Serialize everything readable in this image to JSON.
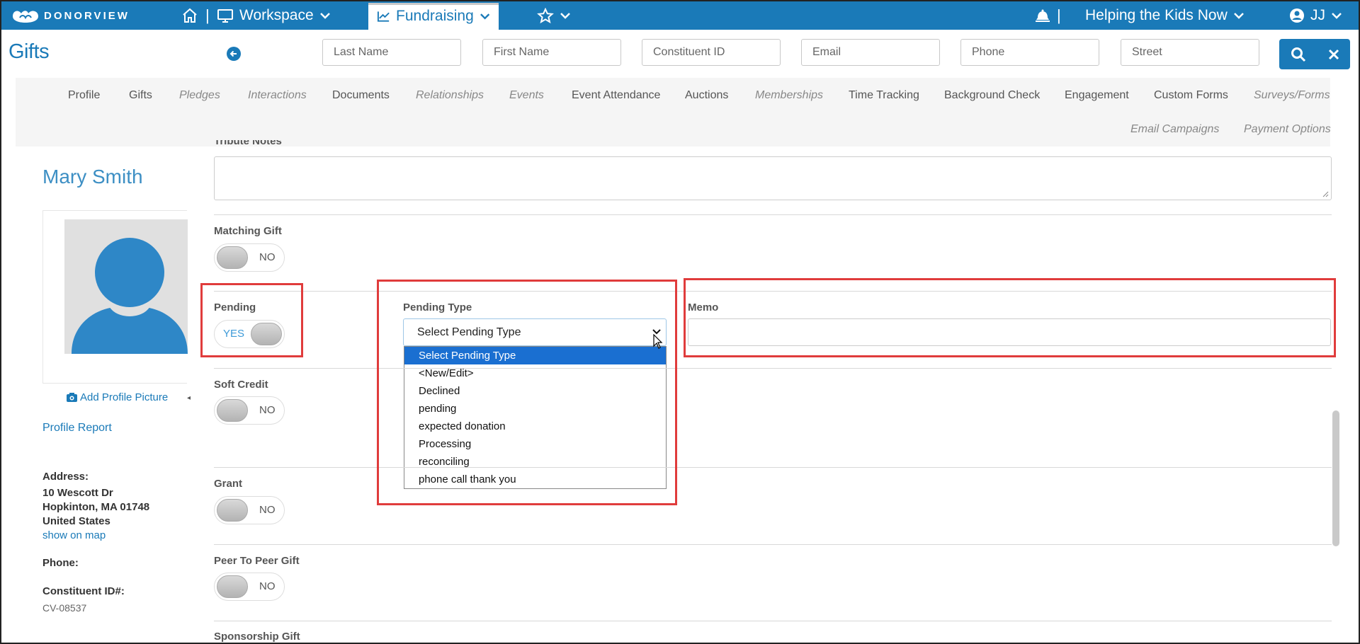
{
  "topbar": {
    "logo_text": "DONORVIEW",
    "workspace_label": "Workspace",
    "fundraising_label": "Fundraising",
    "org_name": "Helping the Kids Now",
    "user_initials": "JJ",
    "separator": "|"
  },
  "header": {
    "page_title": "Gifts",
    "search_fields": [
      {
        "placeholder": "Last Name"
      },
      {
        "placeholder": "First Name"
      },
      {
        "placeholder": "Constituent ID"
      },
      {
        "placeholder": "Email"
      },
      {
        "placeholder": "Phone"
      },
      {
        "placeholder": "Street"
      }
    ]
  },
  "tabs": {
    "row1": [
      {
        "label": "Profile",
        "italic": false
      },
      {
        "label": "Gifts",
        "italic": false
      },
      {
        "label": "Pledges",
        "italic": true
      },
      {
        "label": "Interactions",
        "italic": true
      },
      {
        "label": "Documents",
        "italic": false
      },
      {
        "label": "Relationships",
        "italic": true
      },
      {
        "label": "Events",
        "italic": true
      },
      {
        "label": "Event Attendance",
        "italic": false
      },
      {
        "label": "Auctions",
        "italic": false
      },
      {
        "label": "Memberships",
        "italic": true
      },
      {
        "label": "Time Tracking",
        "italic": false
      },
      {
        "label": "Background Check",
        "italic": false
      },
      {
        "label": "Engagement",
        "italic": false
      },
      {
        "label": "Custom Forms",
        "italic": false
      },
      {
        "label": "Surveys/Forms",
        "italic": true
      }
    ],
    "row2": [
      {
        "label": "Email Campaigns",
        "italic": true
      },
      {
        "label": "Payment Options",
        "italic": true
      }
    ]
  },
  "profile": {
    "name": "Mary Smith",
    "add_picture_label": "Add Profile Picture",
    "report_label": "Profile Report",
    "address_label": "Address:",
    "address_line1": "10 Wescott Dr",
    "address_line2": "Hopkinton, MA 01748",
    "address_line3": "United States",
    "map_link": "show on map",
    "phone_label": "Phone:",
    "constituent_label": "Constituent ID#:",
    "constituent_id": "CV-08537"
  },
  "form": {
    "tribute_notes_label": "Tribute Notes",
    "matching_gift_label": "Matching Gift",
    "matching_gift_value": "NO",
    "pending_label": "Pending",
    "pending_value": "YES",
    "pending_type_label": "Pending Type",
    "pending_type_selected": "Select Pending Type",
    "pending_type_options": [
      "Select Pending Type",
      "<New/Edit>",
      "Declined",
      "pending",
      "expected donation",
      "Processing",
      "reconciling",
      "phone call thank you"
    ],
    "memo_label": "Memo",
    "soft_credit_label": "Soft Credit",
    "soft_credit_value": "NO",
    "grant_label": "Grant",
    "grant_value": "NO",
    "peer_label": "Peer To Peer Gift",
    "peer_value": "NO",
    "sponsorship_label": "Sponsorship Gift"
  },
  "colors": {
    "brand": "#1a7ab8",
    "highlight": "#e03c3c",
    "dropdown_selected": "#1a6fd1"
  }
}
